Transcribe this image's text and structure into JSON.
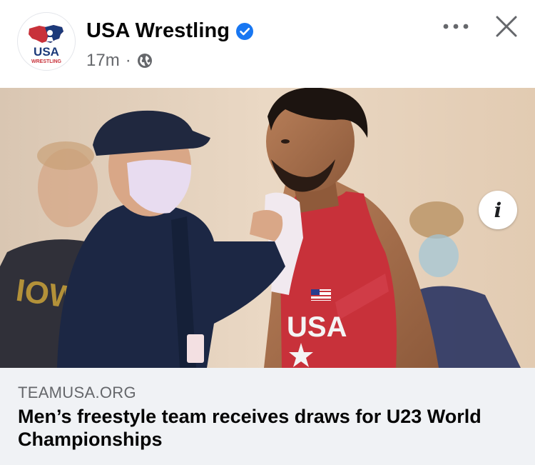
{
  "header": {
    "page_name": "USA Wrestling",
    "timestamp": "17m",
    "separator": "·",
    "avatar_logo_text": "USA",
    "avatar_logo_subtext": "WRESTLING",
    "verified_badge": "verified-icon",
    "audience_icon": "globe-icon",
    "more_icon": "more-dots-icon",
    "close_icon": "close-icon"
  },
  "photo": {
    "info_label": "i",
    "singlet_text": "USA",
    "shirt_text": "IOWA"
  },
  "link": {
    "domain": "TEAMUSA.ORG",
    "headline": "Men’s freestyle team receives draws for U23 World Championships"
  },
  "colors": {
    "verified_blue": "#1877f2",
    "secondary_text": "#65676b",
    "link_background": "#f0f2f5",
    "singlet_red": "#c8313a"
  }
}
